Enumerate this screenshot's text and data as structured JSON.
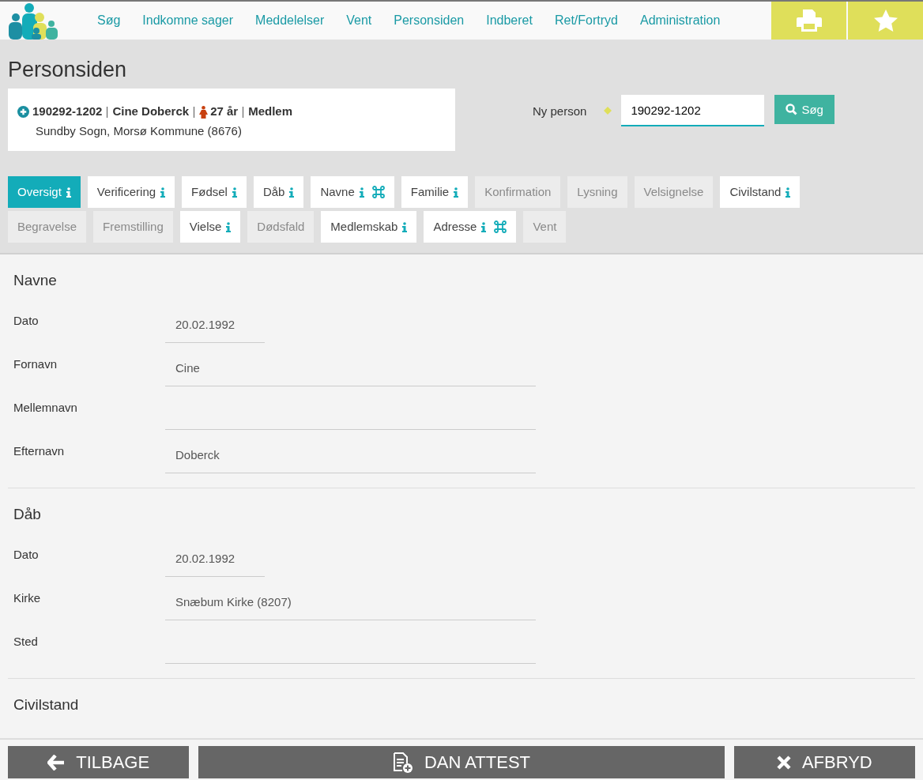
{
  "nav": {
    "items": [
      "Søg",
      "Indkomne sager",
      "Meddelelser",
      "Vent",
      "Personsiden",
      "Indberet",
      "Ret/Fortryd",
      "Administration"
    ]
  },
  "page_title": "Personsiden",
  "person": {
    "cpr": "190292-1202",
    "name": "Cine Doberck",
    "age": "27 år",
    "status": "Medlem",
    "parish": "Sundby Sogn, Morsø Kommune (8676)"
  },
  "search": {
    "label": "Ny person",
    "value": "190292-1202",
    "button": "Søg"
  },
  "tabs": [
    {
      "label": "Oversigt",
      "selected": true,
      "disabled": false,
      "info": true,
      "command": false
    },
    {
      "label": "Verificering",
      "selected": false,
      "disabled": false,
      "info": true,
      "command": false
    },
    {
      "label": "Fødsel",
      "selected": false,
      "disabled": false,
      "info": true,
      "command": false
    },
    {
      "label": "Dåb",
      "selected": false,
      "disabled": false,
      "info": true,
      "command": false
    },
    {
      "label": "Navne",
      "selected": false,
      "disabled": false,
      "info": true,
      "command": true
    },
    {
      "label": "Familie",
      "selected": false,
      "disabled": false,
      "info": true,
      "command": false
    },
    {
      "label": "Konfirmation",
      "selected": false,
      "disabled": true,
      "info": false,
      "command": false
    },
    {
      "label": "Lysning",
      "selected": false,
      "disabled": true,
      "info": false,
      "command": false
    },
    {
      "label": "Velsignelse",
      "selected": false,
      "disabled": true,
      "info": false,
      "command": false
    },
    {
      "label": "Civilstand",
      "selected": false,
      "disabled": false,
      "info": true,
      "command": false
    },
    {
      "label": "Begravelse",
      "selected": false,
      "disabled": true,
      "info": false,
      "command": false
    },
    {
      "label": "Fremstilling",
      "selected": false,
      "disabled": true,
      "info": false,
      "command": false
    },
    {
      "label": "Vielse",
      "selected": false,
      "disabled": false,
      "info": true,
      "command": false
    },
    {
      "label": "Dødsfald",
      "selected": false,
      "disabled": true,
      "info": false,
      "command": false
    },
    {
      "label": "Medlemskab",
      "selected": false,
      "disabled": false,
      "info": true,
      "command": false
    },
    {
      "label": "Adresse",
      "selected": false,
      "disabled": false,
      "info": true,
      "command": true
    },
    {
      "label": "Vent",
      "selected": false,
      "disabled": true,
      "info": false,
      "command": false
    }
  ],
  "sections": [
    {
      "title": "Navne",
      "fields": [
        {
          "label": "Dato",
          "value": "20.02.1992",
          "kind": "date"
        },
        {
          "label": "Fornavn",
          "value": "Cine",
          "kind": "text"
        },
        {
          "label": "Mellemnavn",
          "kind": "text"
        },
        {
          "label": "Efternavn",
          "value": "Doberck",
          "kind": "text"
        }
      ]
    },
    {
      "title": "Dåb",
      "fields": [
        {
          "label": "Dato",
          "value": "20.02.1992",
          "kind": "date"
        },
        {
          "label": "Kirke",
          "value": "Snæbum Kirke (8207)",
          "kind": "text"
        },
        {
          "label": "Sted",
          "kind": "text"
        }
      ]
    },
    {
      "title": "Civilstand"
    }
  ],
  "footer": {
    "back": "TILBAGE",
    "certificate": "DAN ATTEST",
    "cancel": "AFBRYD"
  }
}
